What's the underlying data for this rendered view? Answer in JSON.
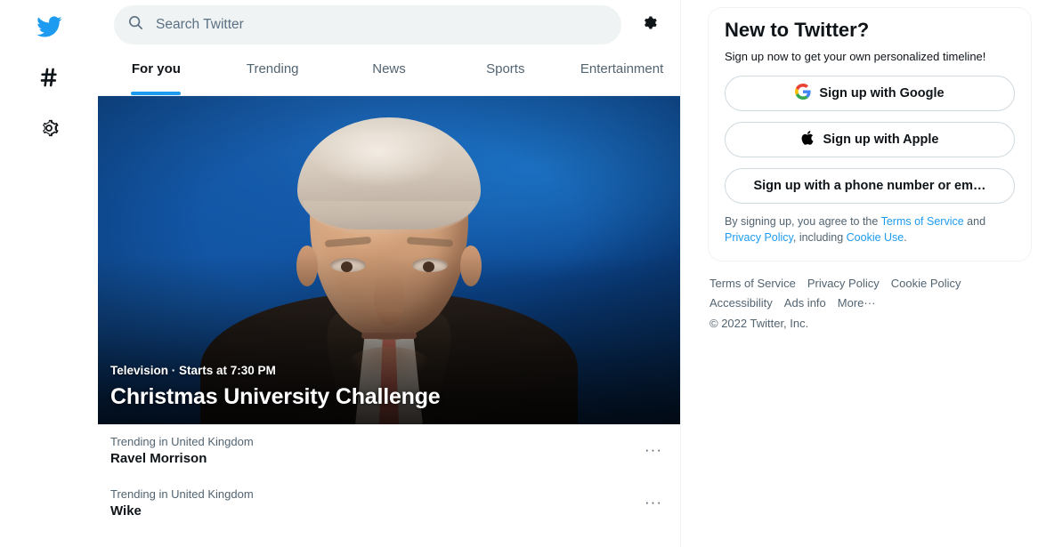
{
  "rail": {
    "items": [
      {
        "name": "twitter-logo",
        "icon": "twitter-bird-icon",
        "label": "Twitter"
      },
      {
        "name": "explore",
        "icon": "hashtag-icon",
        "label": "Explore"
      },
      {
        "name": "settings",
        "icon": "gear-icon",
        "label": "Settings"
      }
    ]
  },
  "search": {
    "placeholder": "Search Twitter",
    "value": "",
    "icon": "search-icon",
    "settings_icon": "gear-icon"
  },
  "tabs": [
    {
      "label": "For you",
      "active": true
    },
    {
      "label": "Trending",
      "active": false
    },
    {
      "label": "News",
      "active": false
    },
    {
      "label": "Sports",
      "active": false
    },
    {
      "label": "Entertainment",
      "active": false
    }
  ],
  "hero": {
    "category": "Television",
    "separator": "·",
    "time": "Starts at 7:30 PM",
    "meta": "Television · Starts at 7:30 PM",
    "title": "Christmas University Challenge"
  },
  "trends": [
    {
      "context": "Trending in United Kingdom",
      "name": "Ravel Morrison",
      "menu": "···"
    },
    {
      "context": "Trending in United Kingdom",
      "name": "Wike",
      "menu": "···"
    }
  ],
  "signup": {
    "title": "New to Twitter?",
    "subtitle": "Sign up now to get your own personalized timeline!",
    "google_label": "Sign up with Google",
    "apple_label": "Sign up with Apple",
    "phone_label": "Sign up with a phone number or em…",
    "legal_prefix": "By signing up, you agree to the ",
    "legal_terms": "Terms of Service",
    "legal_and": " and ",
    "legal_privacy": "Privacy Policy",
    "legal_including": ", including ",
    "legal_cookie": "Cookie Use",
    "legal_suffix": "."
  },
  "footer": {
    "links_row1": [
      "Terms of Service",
      "Privacy Policy",
      "Cookie Policy"
    ],
    "links_row2": [
      "Accessibility",
      "Ads info"
    ],
    "more_label": "More",
    "more_dots": "···",
    "copyright": "© 2022 Twitter, Inc."
  },
  "colors": {
    "accent": "#1d9bf0",
    "text": "#0f1419",
    "muted": "#536471",
    "border": "#eff3f4",
    "search_bg": "#eff3f4"
  }
}
